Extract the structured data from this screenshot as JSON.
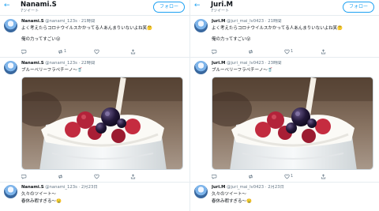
{
  "colors": {
    "accent": "#1da1f2",
    "muted": "#657786",
    "text": "#0f1419"
  },
  "icons": [
    "back-arrow-icon",
    "reply-icon",
    "retweet-icon",
    "like-icon",
    "share-icon",
    "avatar"
  ],
  "panels": [
    {
      "header": {
        "back": "←",
        "name": "Nanami.S",
        "count": "7ツイート",
        "follow": "フォロー"
      },
      "tweets": [
        {
          "name": "Nanami.S",
          "handle": "@nanami_123s",
          "dot": "·",
          "time": "21時間",
          "line1": "よく考えたらコロナウイルスかかってる人あんまりいないよね笑🤔",
          "line2": "俺の力ってすごい😮",
          "replies": "",
          "retweets": "1",
          "likes": "",
          "share": ""
        },
        {
          "name": "Nanami.S",
          "handle": "@nanami_123s",
          "dot": "·",
          "time": "22時間",
          "line1": "ブルーベリーフラペチーノ〜🥤",
          "replies": "",
          "retweets": "",
          "likes": "",
          "share": ""
        },
        {
          "name": "Nanami.S",
          "handle": "@nanami_123s",
          "dot": "·",
          "time": "2月23日",
          "line1": "久々のツイート〜",
          "line2": "春休み暇すぎる〜🤤"
        }
      ]
    },
    {
      "header": {
        "back": "←",
        "name": "Juri.M",
        "count": "7ツイート",
        "follow": "フォロー"
      },
      "tweets": [
        {
          "name": "Juri.M",
          "handle": "@juri_mai_lv0423",
          "dot": "·",
          "time": "21時間",
          "line1": "よく考えたらコロナウイルスかかってる人あんまりいないよね笑🤔",
          "line2": "俺の力ってすごい😮",
          "replies": "",
          "retweets": "",
          "likes": "1",
          "share": ""
        },
        {
          "name": "Juri.M",
          "handle": "@juri_mai_lv0423",
          "dot": "·",
          "time": "23時間",
          "line1": "ブルーベリーフラペチーノ〜🥤",
          "replies": "",
          "retweets": "",
          "likes": "1",
          "share": ""
        },
        {
          "name": "Juri.M",
          "handle": "@juri_mai_lv0423",
          "dot": "·",
          "time": "2月23日",
          "line1": "久々のツイート〜",
          "line2": "春休み暇すぎる〜🤤"
        }
      ]
    }
  ]
}
